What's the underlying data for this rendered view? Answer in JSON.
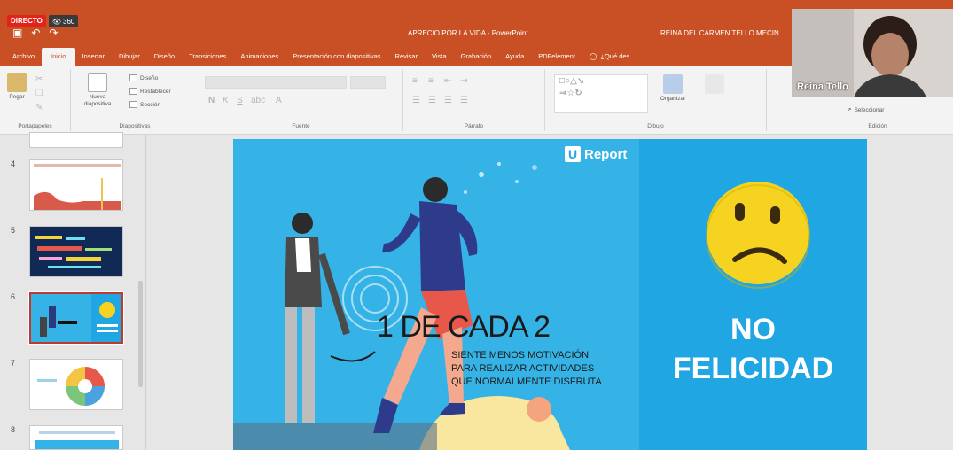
{
  "stream": {
    "live_label": "DIRECTO",
    "viewer_count": "360"
  },
  "window": {
    "doc_title": "APRECIO POR LA VIDA - PowerPoint",
    "user_name": "REINA DEL CARMEN TELLO MECIN"
  },
  "tabs": [
    {
      "label": "Archivo"
    },
    {
      "label": "Inicio"
    },
    {
      "label": "Insertar"
    },
    {
      "label": "Dibujar"
    },
    {
      "label": "Diseño"
    },
    {
      "label": "Transiciones"
    },
    {
      "label": "Animaciones"
    },
    {
      "label": "Presentación con diapositivas"
    },
    {
      "label": "Revisar"
    },
    {
      "label": "Vista"
    },
    {
      "label": "Grabación"
    },
    {
      "label": "Ayuda"
    },
    {
      "label": "PDFelement"
    },
    {
      "label": "¿Qué des"
    }
  ],
  "ribbon": {
    "clipboard": {
      "paste": "Pegar",
      "group": "Portapapeles"
    },
    "slides": {
      "new_slide_line1": "Nueva",
      "new_slide_line2": "diapositiva",
      "design": "Diseño",
      "reset": "Restablecer",
      "section": "Sección",
      "group": "Diapositivas"
    },
    "font_group": "Fuente",
    "paragraph_group": "Párrafo",
    "drawing": {
      "arrange": "Organizar",
      "group": "Dibujo"
    },
    "editing": {
      "select": "Seleccionar",
      "group": "Edición"
    }
  },
  "thumbnails": [
    {
      "num": "4"
    },
    {
      "num": "5"
    },
    {
      "num": "6"
    },
    {
      "num": "7"
    },
    {
      "num": "8"
    }
  ],
  "slide": {
    "brand": "Report",
    "brand_letter": "U",
    "headline": "1 DE CADA 2",
    "sub_line1": "SIENTE MENOS MOTIVACIÓN",
    "sub_line2": "PARA REALIZAR ACTIVIDADES",
    "sub_line3": "QUE NORMALMENTE DISFRUTA",
    "no": "NO",
    "felicidad": "FELICIDAD"
  },
  "webcam": {
    "name": "Reina Tello"
  },
  "colors": {
    "accent": "#c94f24",
    "slide_blue": "#1fa6e3",
    "emoji_yellow": "#f7d321"
  }
}
